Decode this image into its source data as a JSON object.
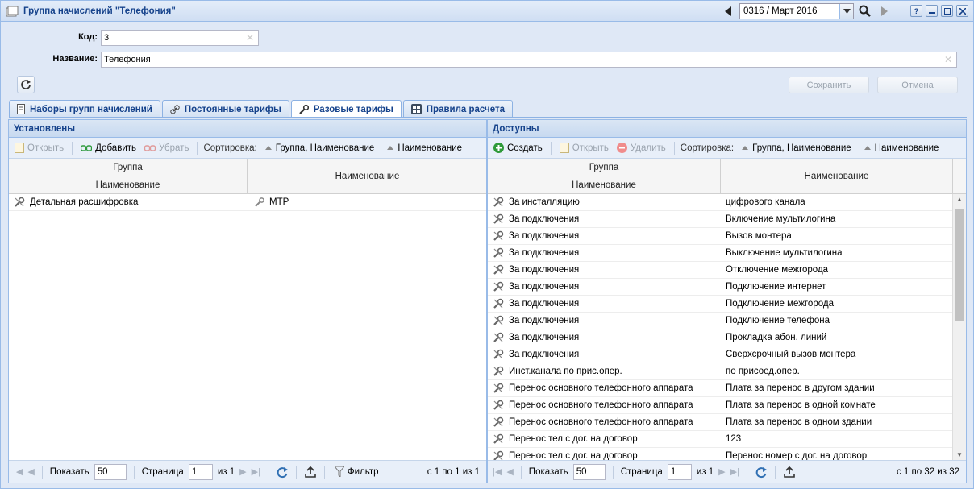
{
  "window": {
    "title": "Группа начислений \"Телефония\"",
    "period": "0316 / Март 2016",
    "help_label": "?"
  },
  "form": {
    "code_label": "Код:",
    "code_value": "3",
    "name_label": "Название:",
    "name_value": "Телефония",
    "save_label": "Сохранить",
    "cancel_label": "Отмена"
  },
  "tabs": [
    {
      "label": "Наборы групп начислений",
      "icon": "notebook-icon"
    },
    {
      "label": "Постоянные тарифы",
      "icon": "link-icon"
    },
    {
      "label": "Разовые тарифы",
      "icon": "wrench-icon",
      "active": true
    },
    {
      "label": "Правила расчета",
      "icon": "calculator-icon"
    }
  ],
  "left": {
    "title": "Установлены",
    "toolbar": {
      "open": "Открыть",
      "add": "Добавить",
      "remove": "Убрать",
      "sort_label": "Сортировка:",
      "sort1": "Группа, Наименование",
      "sort2": "Наименование"
    },
    "columns": {
      "group": "Группа",
      "name_sub": "Наименование",
      "name": "Наименование"
    },
    "rows": [
      {
        "group": "Детальная расшифровка",
        "name": "МТР"
      }
    ],
    "pager": {
      "show_label": "Показать",
      "page_size": "50",
      "page_label": "Страница",
      "page": "1",
      "of": "из 1",
      "filter": "Фильтр",
      "info": "с 1 по 1 из 1"
    }
  },
  "right": {
    "title": "Доступны",
    "toolbar": {
      "create": "Создать",
      "open": "Открыть",
      "delete": "Удалить",
      "sort_label": "Сортировка:",
      "sort1": "Группа, Наименование",
      "sort2": "Наименование"
    },
    "columns": {
      "group": "Группа",
      "name_sub": "Наименование",
      "name": "Наименование"
    },
    "rows": [
      {
        "group": "За инсталляцию",
        "name": "цифрового канала"
      },
      {
        "group": "За подключения",
        "name": "Включение мультилогина"
      },
      {
        "group": "За подключения",
        "name": "Вызов монтера"
      },
      {
        "group": "За подключения",
        "name": "Выключение мультилогина"
      },
      {
        "group": "За подключения",
        "name": "Отключение межгорода"
      },
      {
        "group": "За подключения",
        "name": "Подключение интернет"
      },
      {
        "group": "За подключения",
        "name": "Подключение межгорода"
      },
      {
        "group": "За подключения",
        "name": "Подключение телефона"
      },
      {
        "group": "За подключения",
        "name": "Прокладка абон. линий"
      },
      {
        "group": "За подключения",
        "name": "Сверхсрочный вызов монтера"
      },
      {
        "group": "Инст.канала по прис.опер.",
        "name": "по присоед.опер."
      },
      {
        "group": "Перенос основного телефонного аппарата",
        "name": "Плата за перенос в другом здании"
      },
      {
        "group": "Перенос основного телефонного аппарата",
        "name": "Плата за перенос в одной комнате"
      },
      {
        "group": "Перенос основного телефонного аппарата",
        "name": "Плата за перенос в одном здании"
      },
      {
        "group": "Перенос тел.с дог. на договор",
        "name": "123"
      },
      {
        "group": "Перенос тел.с дог. на договор",
        "name": "Перенос номер с дог. на договор"
      }
    ],
    "pager": {
      "show_label": "Показать",
      "page_size": "50",
      "page_label": "Страница",
      "page": "1",
      "of": "из 1",
      "info": "с 1 по 32 из 32"
    }
  }
}
